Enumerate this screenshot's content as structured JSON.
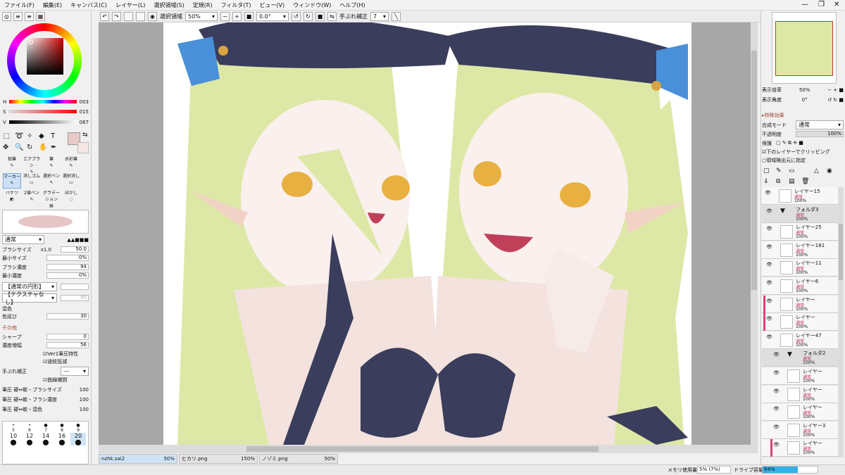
{
  "menu": [
    "ファイル(F)",
    "編集(E)",
    "キャンバス(C)",
    "レイヤー(L)",
    "選択領域(S)",
    "定規(R)",
    "フィルタ(T)",
    "ビュー(V)",
    "ウィンドウ(W)",
    "ヘルプ(H)"
  ],
  "toolbar": {
    "selection_label": "選択領域",
    "zoom": "50%",
    "angle": "0.0°",
    "stabilizer_label": "手ぶれ補正",
    "stabilizer_value": "7"
  },
  "color": {
    "h_label": "H",
    "h_value": "003",
    "s_label": "S",
    "s_value": "015",
    "v_label": "V",
    "v_value": "087",
    "current": "#e8cac6"
  },
  "tools": [
    "鉛筆",
    "エアブラシ",
    "筆",
    "水彩筆",
    "マーカー",
    "消しゴム",
    "選択ペン",
    "選択消し",
    "バケツ",
    "2値ペン",
    "グラデーション",
    "ぼかし"
  ],
  "brush": {
    "mode": "通常",
    "size_label": "ブラシサイズ",
    "size_mult": "x1.0",
    "size_value": "50.0",
    "min_size_label": "最小サイズ",
    "min_size_value": "0%",
    "density_label": "ブラシ濃度",
    "density_value": "94",
    "min_density_label": "最小濃度",
    "min_density_value": "0%",
    "shape": "【通常の円形】",
    "texture": "【テクスチャなし】",
    "texture_value": "95",
    "mix_label": "混色",
    "blend_label": "色延び",
    "blend_value": "30",
    "other_label": "その他",
    "sharp_label": "シャープ",
    "sharp_value": "0",
    "boost_label": "濃度増幅",
    "boost_value": "56",
    "ver1": "Ver1筆圧特性",
    "wavy": "波紋抵減",
    "stab_label": "手ぶれ補正",
    "stab_value": "---",
    "curve": "曲線補間",
    "p1": "筆圧 硬⇔軟・ブラシサイズ",
    "p1v": "100",
    "p2": "筆圧 硬⇔軟・ブラシ濃度",
    "p2v": "100",
    "p3": "筆圧 硬⇔軟・混色",
    "p3v": "100"
  },
  "sizes": [
    "5",
    "6",
    "7",
    "8",
    "9",
    "10",
    "12",
    "14",
    "16",
    "20"
  ],
  "nav": {
    "zoom_label": "表示倍率",
    "zoom_value": "50%",
    "angle_label": "表示角度",
    "angle_value": "0°"
  },
  "layer_props": {
    "effects": "特殊効果",
    "blend_label": "合成モード",
    "blend_value": "通常",
    "opacity_label": "不透明度",
    "opacity_value": "100%",
    "protect_label": "保護",
    "clip": "下のレイヤーでクリッピング",
    "source": "領域検出元に指定"
  },
  "layers": [
    {
      "name": "レイヤー15",
      "mode": "通常",
      "op": "100%"
    },
    {
      "name": "フォルダ3",
      "mode": "通常",
      "op": "100%"
    },
    {
      "name": "レイヤー25",
      "mode": "通常",
      "op": "100%"
    },
    {
      "name": "レイヤー181",
      "mode": "通常",
      "op": "100%"
    },
    {
      "name": "レイヤー11",
      "mode": "通常",
      "op": "100%"
    },
    {
      "name": "レイヤー6",
      "mode": "通常",
      "op": "100%"
    },
    {
      "name": "レイヤー",
      "mode": "通常",
      "op": "100%"
    },
    {
      "name": "レイヤー",
      "mode": "通常",
      "op": "100%"
    },
    {
      "name": "レイヤー47",
      "mode": "通常",
      "op": "100%"
    },
    {
      "name": "フォルダ2",
      "mode": "通常",
      "op": "100%"
    },
    {
      "name": "レイヤー",
      "mode": "通常",
      "op": "100%"
    },
    {
      "name": "レイヤー",
      "mode": "通常",
      "op": "100%"
    },
    {
      "name": "レイヤー",
      "mode": "通常",
      "op": "100%"
    },
    {
      "name": "レイヤー3",
      "mode": "通常",
      "op": "100%"
    },
    {
      "name": "レイヤー",
      "mode": "通常",
      "op": "100%"
    }
  ],
  "tabs": [
    {
      "name": "nzhk.sai2",
      "zoom": "50%"
    },
    {
      "name": "ヒカリ.png",
      "zoom": "150%"
    },
    {
      "name": "ノゾミ.png",
      "zoom": "50%"
    }
  ],
  "status": {
    "mem_label": "メモリ使用量",
    "mem_value": "5% (7%)",
    "drive_label": "ドライブ容量",
    "drive_value": "64%",
    "drive_fraction": 0.64
  }
}
